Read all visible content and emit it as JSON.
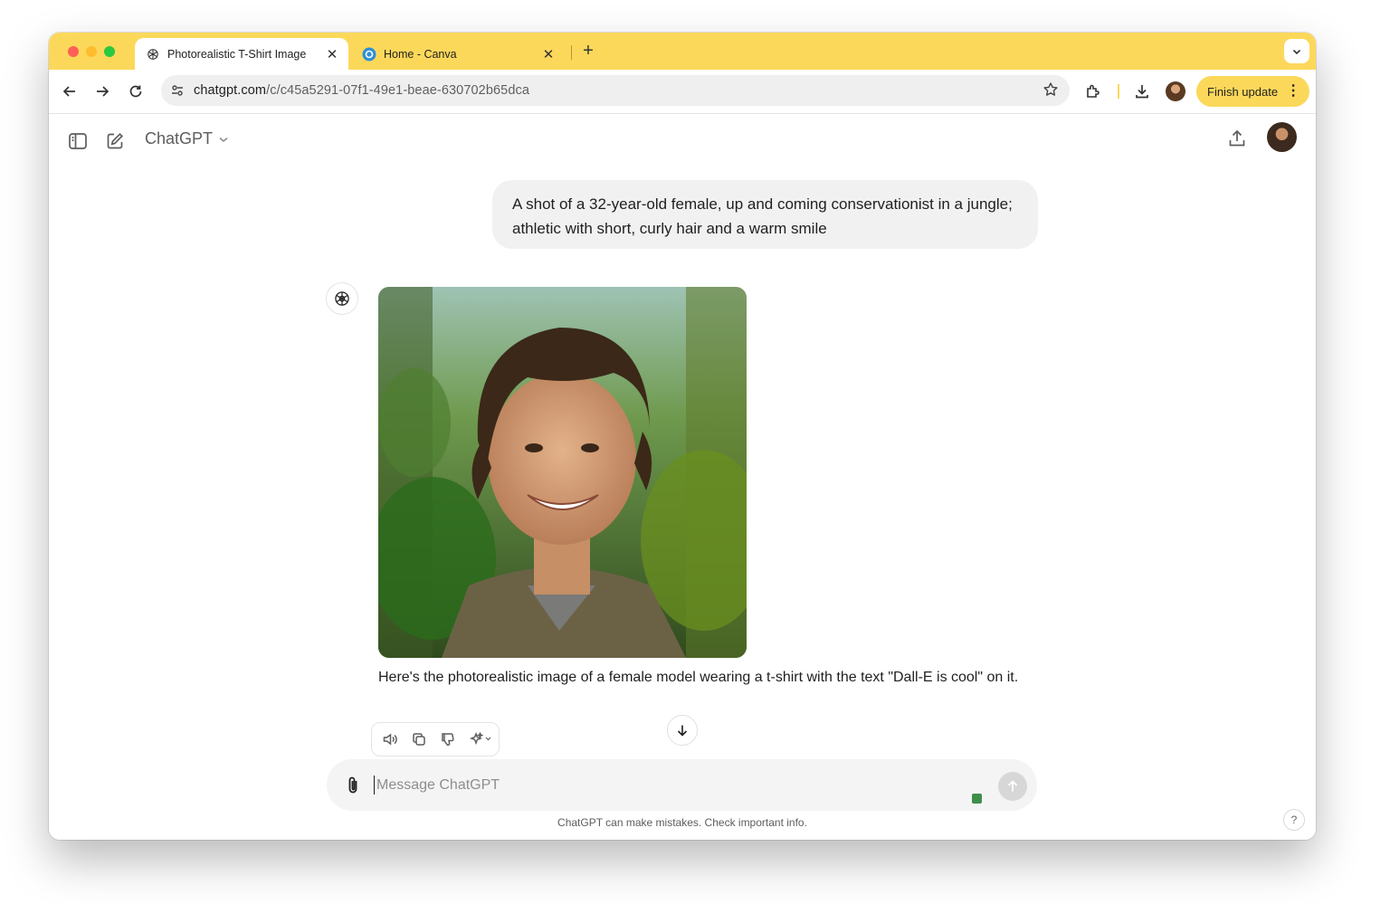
{
  "browser": {
    "tabs": [
      {
        "title": "Photorealistic T-Shirt Image",
        "active": true,
        "favicon": "openai-icon"
      },
      {
        "title": "Home - Canva",
        "active": false,
        "favicon": "canva-icon"
      }
    ],
    "address_bar": {
      "host": "chatgpt.com",
      "path": "/c/c45a5291-07f1-49e1-beae-630702b65dca"
    },
    "finish_update_label": "Finish update",
    "colors": {
      "tab_strip": "#fcd85a",
      "update_button": "#fcd85a"
    }
  },
  "app": {
    "model_name": "ChatGPT",
    "user_message": "A shot of a 32-year-old female, up and coming conservationist in a jungle; athletic with short, curly hair and a warm smile",
    "assistant_reply": "Here's the photorealistic image of a female model wearing a t-shirt with the text \"Dall-E is cool\" on it.",
    "composer_placeholder": "Message ChatGPT",
    "disclaimer": "ChatGPT can make mistakes. Check important info.",
    "help_label": "?"
  }
}
